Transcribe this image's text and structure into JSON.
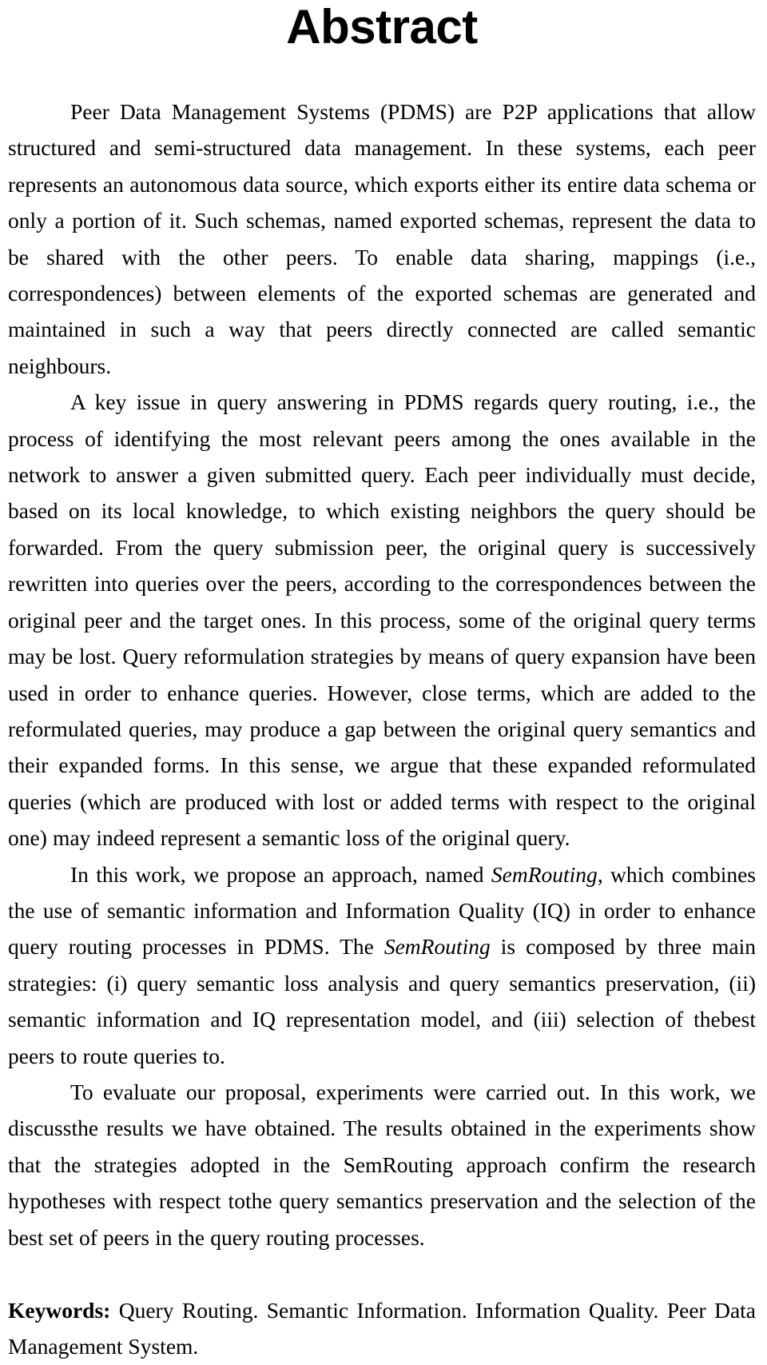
{
  "document": {
    "title": "Abstract",
    "paragraphs": [
      {
        "id": "p1",
        "text_before_italic": "Peer Data Management Systems (PDMS) are P2P applications that allow structured and semi-structured data management. In these systems, each peer represents an autonomous data source, which exports either its entire data schema or only a portion of it. Such schemas, named exported schemas, represent the data to be shared with the other peers. To enable data sharing, mappings (i.e., correspondences) between elements of the exported schemas are generated and maintained in such a way that peers directly connected are called semantic neighbours."
      },
      {
        "id": "p2",
        "text_before_italic": "A key issue in query answering in PDMS regards query routing, i.e., the process of identifying the most relevant peers among the ones available in the network to answer a given submitted query. Each peer individually must decide, based on its local knowledge, to which existing neighbors the query should be forwarded. From the query submission peer, the original query is successively rewritten into queries over the peers, according to the correspondences between the original peer and the target ones. In this process, some of the original query terms may be lost. Query reformulation strategies by means of query expansion have been used in order to enhance queries. However, close terms, which are added to the reformulated queries, may produce a gap between the original query semantics and their expanded forms. In this sense, we argue that these expanded reformulated queries (which are produced with lost or added terms with respect to the original one) may indeed represent a semantic loss of the original query."
      }
    ],
    "paragraph3": {
      "segment_1": "In this work, we propose an approach, named ",
      "italic_1": "SemRouting",
      "segment_2": ", which combines the use of semantic information and Information Quality (IQ) in order to enhance query routing processes in PDMS. The ",
      "italic_2": "SemRouting",
      "segment_3": " is composed by three main strategies: (i) query semantic loss analysis and query semantics preservation, (ii) semantic information and IQ representation model, and (iii) selection of thebest peers to route queries to."
    },
    "paragraph4": {
      "text": "To evaluate our proposal, experiments were carried out. In this work, we discussthe results we have obtained. The results obtained in the experiments show that the strategies adopted in the SemRouting approach confirm the research hypotheses with respect tothe query semantics preservation and the selection of the best set of peers in the query routing processes."
    },
    "keywords": {
      "label": "Keywords:",
      "text": " Query Routing. Semantic Information. Information Quality. Peer Data Management System."
    }
  }
}
